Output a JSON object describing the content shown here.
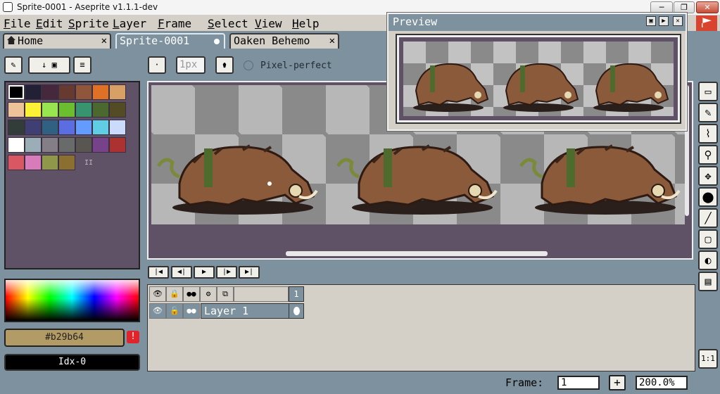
{
  "window": {
    "title": "Sprite-0001 - Aseprite v1.1.1-dev",
    "buttons": {
      "minimize": "─",
      "maximize": "❐",
      "close": "✕"
    }
  },
  "menu": [
    "File",
    "Edit",
    "Sprite",
    "Layer",
    "Frame",
    "Select",
    "View",
    "Help"
  ],
  "tabs": [
    {
      "label": "Home",
      "close": "✕"
    },
    {
      "label": "Sprite-0001"
    },
    {
      "label": "Oaken Behemo",
      "close": "✕"
    }
  ],
  "toolbar": {
    "brush_type": "·",
    "brush_size": "1px",
    "pixel_perfect_label": "Pixel-perfect"
  },
  "palette": {
    "colors": [
      "#000000",
      "#222034",
      "#45283c",
      "#663931",
      "#8f563b",
      "#df7126",
      "#d9a066",
      "#eec39a",
      "#fbf236",
      "#99e550",
      "#6abe30",
      "#37946e",
      "#4b692f",
      "#524b24",
      "#323c39",
      "#3f3f74",
      "#306082",
      "#5b6ee1",
      "#639bff",
      "#5fcde4",
      "#cbdbfc",
      "#ffffff",
      "#9badb7",
      "#847e87",
      "#696a6a",
      "#595652",
      "#76428a",
      "#ac3232",
      "#d95763",
      "#d77bba",
      "#8f974a",
      "#8a6f30"
    ],
    "more_label": "II"
  },
  "color": {
    "hex": "#b29b64",
    "warning": "!",
    "index": "Idx-0"
  },
  "preview": {
    "title": "Preview",
    "buttons": [
      "▣",
      "▶",
      "✕"
    ]
  },
  "playback": [
    "|◀",
    "◀|",
    "▶",
    "|▶",
    "▶|"
  ],
  "timeline": {
    "header_icons": [
      "eye-icon",
      "lock-icon",
      "continuous-icon",
      "gear-icon",
      "onion-skin-icon"
    ],
    "frame_number": "1",
    "layer_name": "Layer 1"
  },
  "tools": [
    "▭",
    "✎",
    "⌇",
    "⚲",
    "✥",
    "⬤",
    "╱",
    "▢",
    "◐",
    "▤"
  ],
  "ratio_label": "1:1",
  "status": {
    "frame_label": "Frame:",
    "frame_value": "1",
    "add": "+",
    "zoom": "200.0%"
  }
}
